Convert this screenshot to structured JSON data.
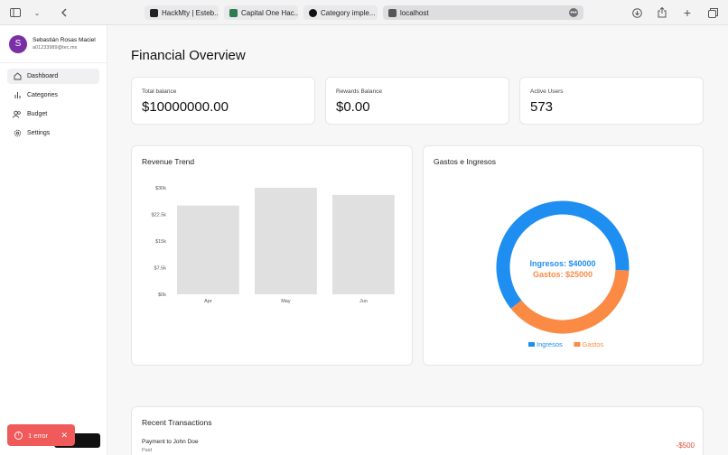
{
  "browser": {
    "tabs": [
      {
        "label": "HackMty | Esteb...",
        "favicon_color": "#222222"
      },
      {
        "label": "Capital One Hac...",
        "favicon_color": "#2e7d4f"
      },
      {
        "label": "Category imple...",
        "favicon_color": "#111111"
      },
      {
        "label": "localhost",
        "favicon_color": "#555555"
      }
    ],
    "icons": [
      "sidebar-icon",
      "chevron-down-icon",
      "back-icon",
      "download-icon",
      "share-icon",
      "plus-icon",
      "tabs-icon"
    ]
  },
  "sidebar": {
    "user": {
      "initial": "S",
      "name": "Sebastián Rosas Maciel",
      "email": "a01233989@tec.mx",
      "avatar_color": "#7b2fa5"
    },
    "items": [
      {
        "label": "Dashboard",
        "icon": "home-icon",
        "active": true
      },
      {
        "label": "Categories",
        "icon": "bar-chart-icon",
        "active": false
      },
      {
        "label": "Budget",
        "icon": "users-icon",
        "active": false
      },
      {
        "label": "Settings",
        "icon": "gear-icon",
        "active": false
      }
    ]
  },
  "main": {
    "title": "Financial Overview",
    "stats": [
      {
        "label": "Total balance",
        "value": "$10000000.00"
      },
      {
        "label": "Rewards Balance",
        "value": "$0.00"
      },
      {
        "label": "Active Users",
        "value": "573"
      }
    ],
    "revenue_title": "Revenue Trend",
    "donut_title": "Gastos e Ingresos",
    "transactions": {
      "title": "Recent Transactions",
      "rows": [
        {
          "title": "Payment to John Doe",
          "status": "Paid",
          "amount": "-$500"
        }
      ]
    }
  },
  "toast": {
    "label": "1 error"
  },
  "chart_data": [
    {
      "type": "bar",
      "title": "Revenue Trend",
      "categories": [
        "Apr",
        "May",
        "Jun"
      ],
      "values": [
        25000,
        30000,
        28000
      ],
      "yticks": [
        "$0k",
        "$7.5k",
        "$15k",
        "$22.5k",
        "$30k"
      ],
      "ylim": [
        0,
        30000
      ],
      "bar_color": "#e0e0e0"
    },
    {
      "type": "pie",
      "title": "Gastos e Ingresos",
      "series": [
        {
          "name": "Ingresos",
          "value": 40000,
          "label": "Ingresos: $40000",
          "color": "#1f8ef1"
        },
        {
          "name": "Gastos",
          "value": 25000,
          "label": "Gastos: $25000",
          "color": "#fb8a45"
        }
      ],
      "legend": "bottom"
    }
  ]
}
